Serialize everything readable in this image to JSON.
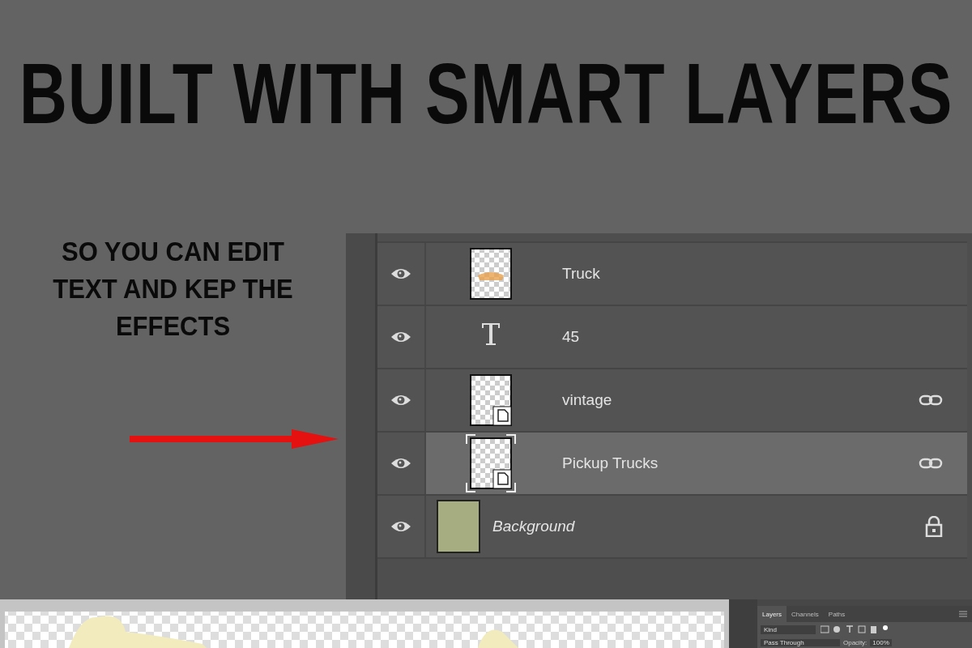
{
  "headline": "BUILT WITH SMART LAYERS",
  "caption": "SO YOU CAN EDIT TEXT AND KEP THE EFFECTS",
  "layers": [
    {
      "kind": "image",
      "name": "Truck",
      "selected": false,
      "visible": true,
      "linked": false,
      "locked": false
    },
    {
      "kind": "text",
      "name": "45",
      "selected": false,
      "visible": true,
      "linked": false,
      "locked": false
    },
    {
      "kind": "smart",
      "name": "vintage",
      "selected": false,
      "visible": true,
      "linked": true,
      "locked": false
    },
    {
      "kind": "smart",
      "name": "Pickup Trucks",
      "selected": true,
      "visible": true,
      "linked": true,
      "locked": false
    },
    {
      "kind": "fill",
      "name": "Background",
      "selected": false,
      "visible": true,
      "linked": false,
      "locked": true
    }
  ],
  "mini_panel": {
    "tabs": [
      {
        "label": "Layers",
        "selected": true
      },
      {
        "label": "Channels",
        "selected": false
      },
      {
        "label": "Paths",
        "selected": false
      }
    ],
    "filter": "Kind",
    "blend_mode": "Pass Through",
    "opacity_label": "Opacity:",
    "opacity": "100%"
  }
}
